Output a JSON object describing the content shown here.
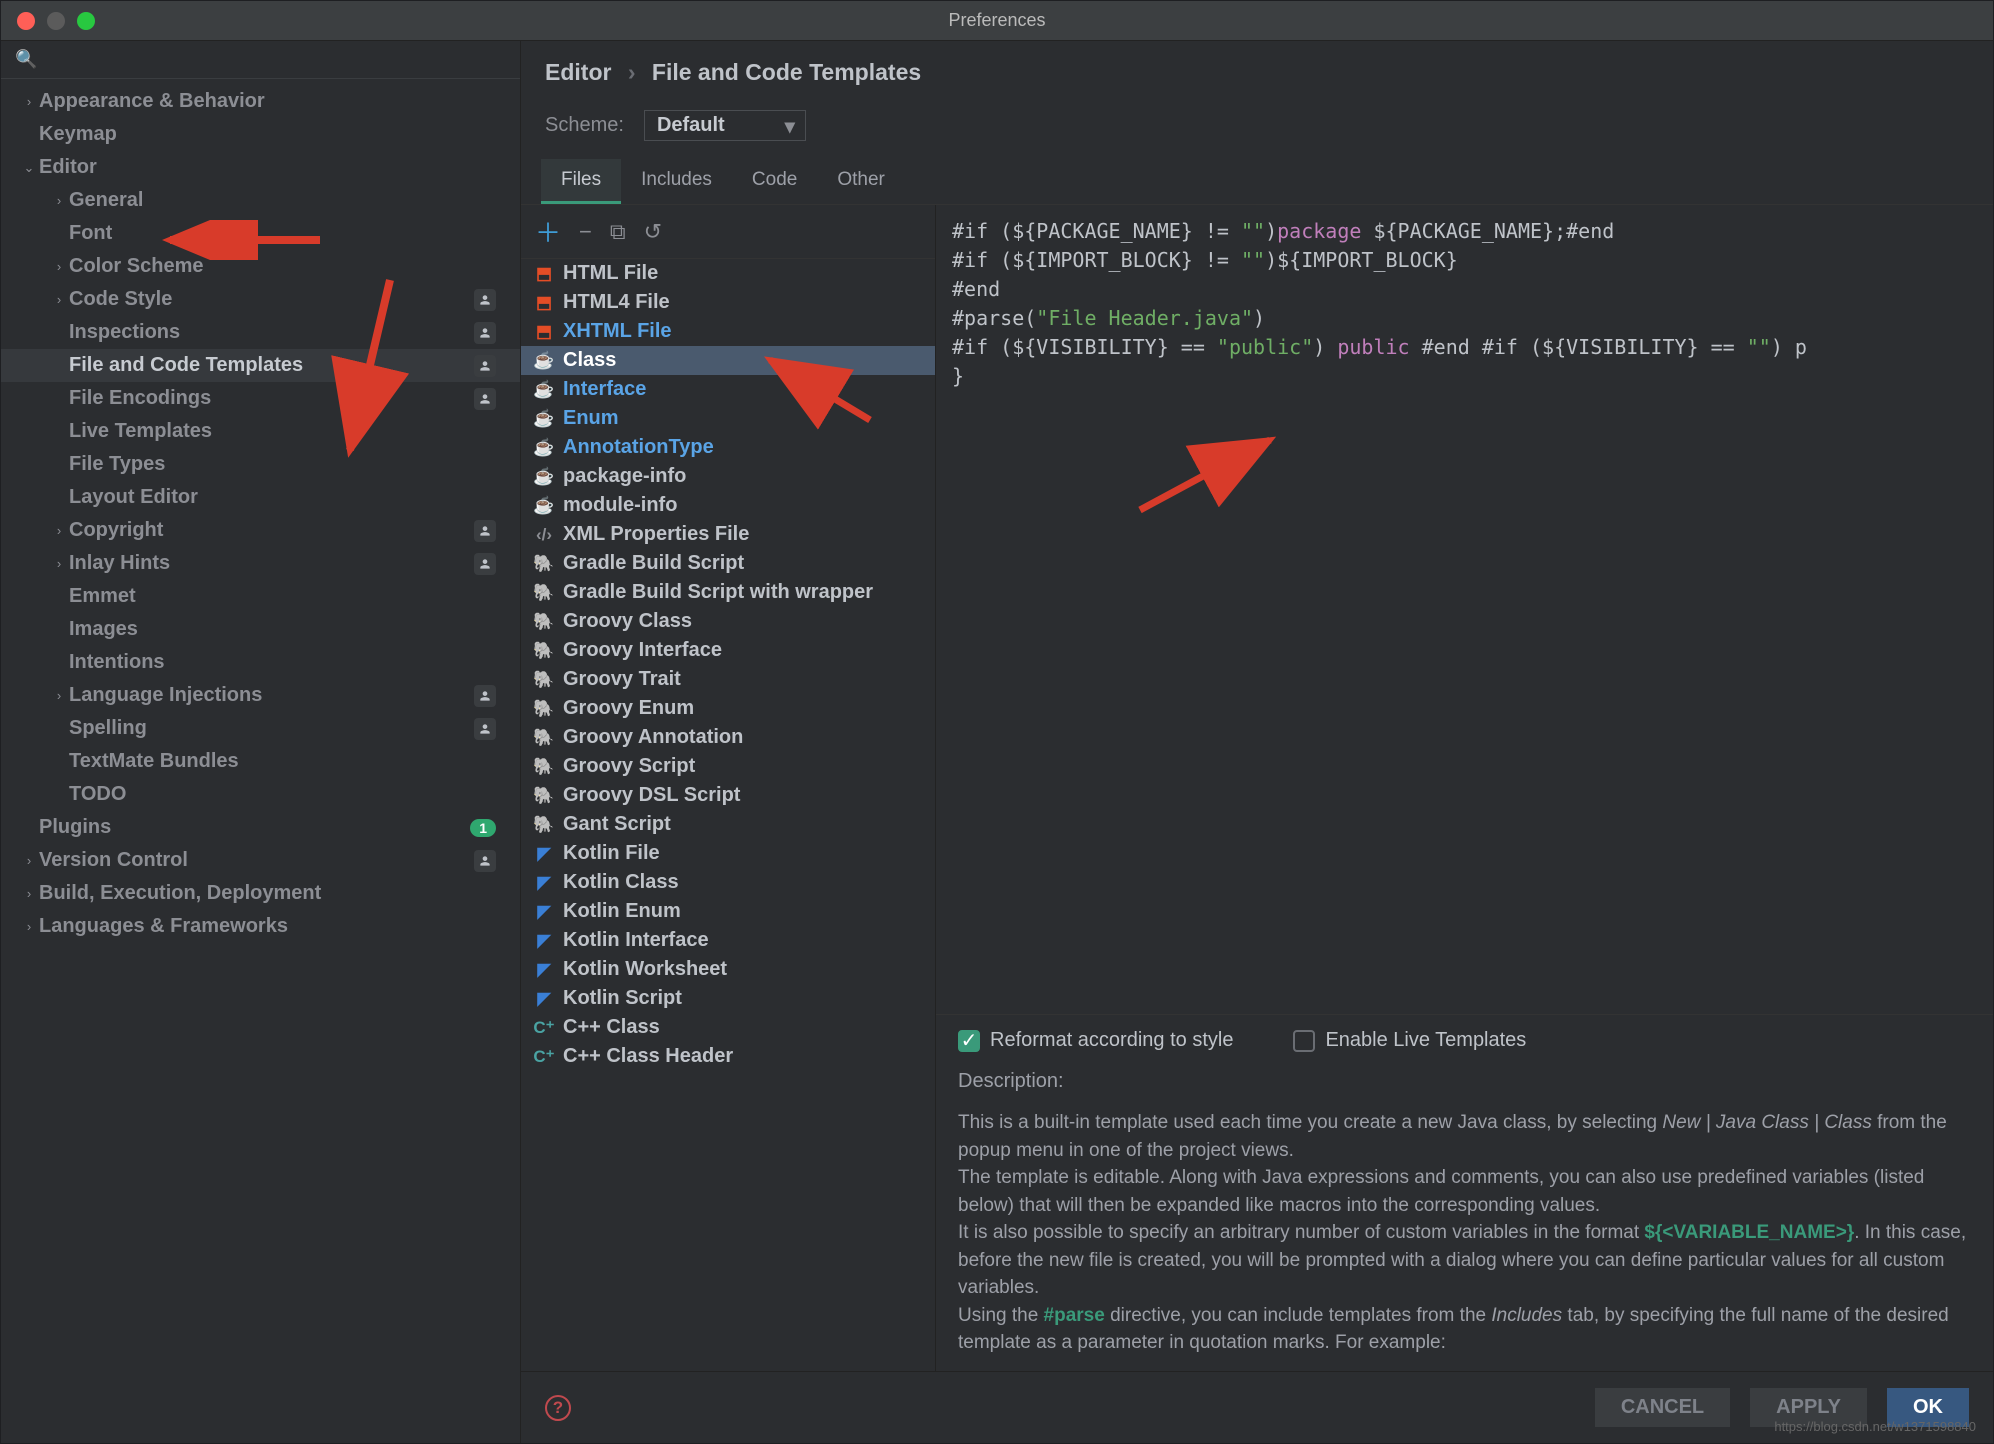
{
  "window": {
    "title": "Preferences"
  },
  "search": {
    "placeholder": ""
  },
  "tree": [
    {
      "label": "Appearance & Behavior",
      "level": 0,
      "chev": ">"
    },
    {
      "label": "Keymap",
      "level": 0
    },
    {
      "label": "Editor",
      "level": 0,
      "chev": "v"
    },
    {
      "label": "General",
      "level": 1,
      "chev": ">"
    },
    {
      "label": "Font",
      "level": 1
    },
    {
      "label": "Color Scheme",
      "level": 1,
      "chev": ">"
    },
    {
      "label": "Code Style",
      "level": 1,
      "chev": ">",
      "person": true
    },
    {
      "label": "Inspections",
      "level": 1,
      "person": true
    },
    {
      "label": "File and Code Templates",
      "level": 1,
      "person": true,
      "selected": true
    },
    {
      "label": "File Encodings",
      "level": 1,
      "person": true
    },
    {
      "label": "Live Templates",
      "level": 1
    },
    {
      "label": "File Types",
      "level": 1
    },
    {
      "label": "Layout Editor",
      "level": 1
    },
    {
      "label": "Copyright",
      "level": 1,
      "chev": ">",
      "person": true
    },
    {
      "label": "Inlay Hints",
      "level": 1,
      "chev": ">",
      "person": true
    },
    {
      "label": "Emmet",
      "level": 1
    },
    {
      "label": "Images",
      "level": 1
    },
    {
      "label": "Intentions",
      "level": 1
    },
    {
      "label": "Language Injections",
      "level": 1,
      "chev": ">",
      "person": true
    },
    {
      "label": "Spelling",
      "level": 1,
      "person": true
    },
    {
      "label": "TextMate Bundles",
      "level": 1
    },
    {
      "label": "TODO",
      "level": 1
    },
    {
      "label": "Plugins",
      "level": 0,
      "count": "1"
    },
    {
      "label": "Version Control",
      "level": 0,
      "chev": ">",
      "person": true
    },
    {
      "label": "Build, Execution, Deployment",
      "level": 0,
      "chev": ">"
    },
    {
      "label": "Languages & Frameworks",
      "level": 0,
      "chev": ">"
    }
  ],
  "crumbs": {
    "a": "Editor",
    "b": "File and Code Templates"
  },
  "scheme": {
    "label": "Scheme:",
    "value": "Default"
  },
  "tabs": [
    "Files",
    "Includes",
    "Code",
    "Other"
  ],
  "activeTab": 0,
  "templates": [
    {
      "name": "HTML File",
      "icon": "html5"
    },
    {
      "name": "HTML4 File",
      "icon": "html5"
    },
    {
      "name": "XHTML File",
      "icon": "html5",
      "link": true
    },
    {
      "name": "Class",
      "icon": "java",
      "selected": true
    },
    {
      "name": "Interface",
      "icon": "java",
      "link": true
    },
    {
      "name": "Enum",
      "icon": "java",
      "link": true
    },
    {
      "name": "AnnotationType",
      "icon": "java",
      "link": true
    },
    {
      "name": "package-info",
      "icon": "java"
    },
    {
      "name": "module-info",
      "icon": "java"
    },
    {
      "name": "XML Properties File",
      "icon": "xml"
    },
    {
      "name": "Gradle Build Script",
      "icon": "gradle"
    },
    {
      "name": "Gradle Build Script with wrapper",
      "icon": "gradle"
    },
    {
      "name": "Groovy Class",
      "icon": "groovy"
    },
    {
      "name": "Groovy Interface",
      "icon": "groovy"
    },
    {
      "name": "Groovy Trait",
      "icon": "groovy"
    },
    {
      "name": "Groovy Enum",
      "icon": "groovy"
    },
    {
      "name": "Groovy Annotation",
      "icon": "groovy"
    },
    {
      "name": "Groovy Script",
      "icon": "groovy"
    },
    {
      "name": "Groovy DSL Script",
      "icon": "groovy"
    },
    {
      "name": "Gant Script",
      "icon": "groovy"
    },
    {
      "name": "Kotlin File",
      "icon": "kotlin"
    },
    {
      "name": "Kotlin Class",
      "icon": "kotlin"
    },
    {
      "name": "Kotlin Enum",
      "icon": "kotlin"
    },
    {
      "name": "Kotlin Interface",
      "icon": "kotlin"
    },
    {
      "name": "Kotlin Worksheet",
      "icon": "kotlin"
    },
    {
      "name": "Kotlin Script",
      "icon": "kotlin"
    },
    {
      "name": "C++ Class",
      "icon": "cpp"
    },
    {
      "name": "C++ Class Header",
      "icon": "cpp"
    }
  ],
  "code_lines": [
    [
      {
        "t": "#if (${PACKAGE_NAME} != "
      },
      {
        "t": "\"\"",
        "c": "cs"
      },
      {
        "t": ")"
      },
      {
        "t": "package",
        "c": "ck"
      },
      {
        "t": " ${PACKAGE_NAME};#end"
      }
    ],
    [
      {
        "t": ""
      }
    ],
    [
      {
        "t": "#if (${IMPORT_BLOCK} != "
      },
      {
        "t": "\"\"",
        "c": "cs"
      },
      {
        "t": ")${IMPORT_BLOCK}"
      }
    ],
    [
      {
        "t": "#end"
      }
    ],
    [
      {
        "t": "#parse("
      },
      {
        "t": "\"File Header.java\"",
        "c": "cs"
      },
      {
        "t": ")"
      }
    ],
    [
      {
        "t": "#if (${VISIBILITY} == "
      },
      {
        "t": "\"public\"",
        "c": "cs"
      },
      {
        "t": ") "
      },
      {
        "t": "public",
        "c": "ck"
      },
      {
        "t": " #end #if (${VISIBILITY} == "
      },
      {
        "t": "\"\"",
        "c": "cs"
      },
      {
        "t": ") p"
      }
    ],
    [
      {
        "t": "}"
      }
    ]
  ],
  "checks": {
    "reformat_label": "Reformat according to style",
    "reformat_checked": true,
    "live_label": "Enable Live Templates",
    "live_checked": false
  },
  "desc": {
    "title": "Description:",
    "p1a": "This is a built-in template used each time you create a new Java class, by selecting ",
    "p1b": "New | Java Class | Class",
    "p1c": " from the popup menu in one of the project views.",
    "p2": "The template is editable. Along with Java expressions and comments, you can also use predefined variables (listed below) that will then be expanded like macros into the corresponding values.",
    "p3a": "It is also possible to specify an arbitrary number of custom variables in the format ",
    "p3var": "${<VARIABLE_NAME>}",
    "p3b": ". In this case, before the new file is created, you will be prompted with a dialog where you can define particular values for all custom variables.",
    "p4a": "Using the ",
    "p4dir": "#parse",
    "p4b": " directive, you can include templates from the ",
    "p4c": "Includes",
    "p4d": " tab, by specifying the full name of the desired template as a parameter in quotation marks. For example:"
  },
  "footer": {
    "cancel": "CANCEL",
    "apply": "APPLY",
    "ok": "OK"
  },
  "watermark": "https://blog.csdn.net/w1371598840",
  "icons": {
    "html5": "🟧",
    "java": "☕",
    "xml": "</>",
    "gradle": "🐘",
    "groovy": "🐘",
    "kotlin": "◤",
    "cpp": "C⁺"
  }
}
